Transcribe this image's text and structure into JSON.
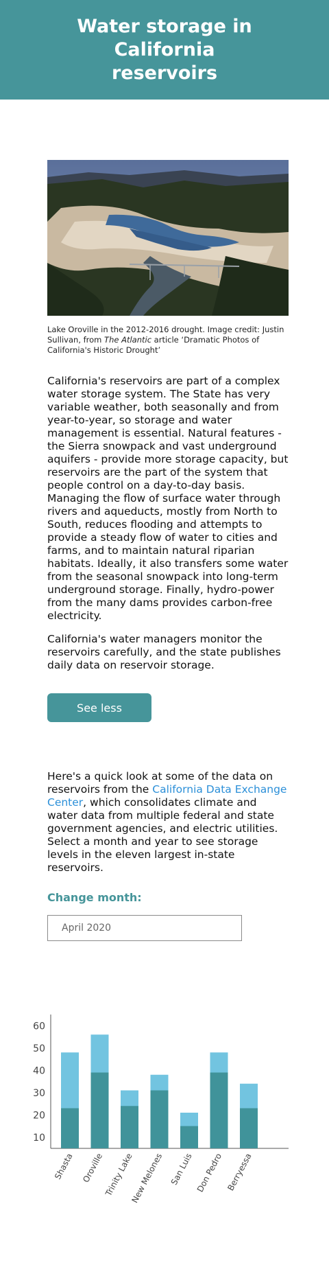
{
  "header": {
    "title": "Water storage in California reservoirs"
  },
  "photo": {
    "caption_pre": "Lake Oroville in the 2012-2016 drought. Image credit: Justin Sullivan, from ",
    "caption_italic": "The Atlantic",
    "caption_post": " article ‘Dramatic Photos of California's Historic Drought’"
  },
  "intro": {
    "p1": "California's reservoirs are part of a complex water storage system. The State has very variable weather, both seasonally and from year-to-year, so storage and water management is essential.  Natural features - the Sierra snowpack and vast underground aquifers - provide more storage capacity,  but reservoirs are the part of the system that people control on a day-to-day basis.  Managing the flow of surface water through rivers and aqueducts, mostly from North to South, reduces flooding and attempts to provide a steady flow of water to cities and farms, and to maintain natural riparian habitats.  Ideally, it also transfers some water from the seasonal snowpack into long-term underground storage.  Finally, hydro-power from the many dams provides carbon-free electricity.",
    "p2": "California's water managers monitor the reservoirs carefully, and the state publishes daily data on reservoir storage.",
    "see_less_label": "See less"
  },
  "data_intro": {
    "pre": "Here's a quick look at some of the data on reservoirs from the ",
    "link_text": "California Data Exchange Center",
    "post": ", which consolidates climate and water data from multiple federal and state government agencies, and  electric utilities. Select a month and year to see storage levels in the eleven largest in-state reservoirs."
  },
  "controls": {
    "change_month_label": "Change month:",
    "month_value": "April 2020"
  },
  "colors": {
    "brand": "#46959a",
    "bar_storage": "#40939a",
    "bar_capacity": "#72c4e0",
    "link": "#2b8fd8"
  },
  "chart_data": {
    "type": "bar",
    "categories": [
      "Shasta",
      "Oroville",
      "Trinity Lake",
      "New Melones",
      "San Luis",
      "Don Pedro",
      "Berryessa"
    ],
    "series": [
      {
        "values": [
          23,
          39,
          24,
          31,
          15,
          39,
          23
        ]
      },
      {
        "values": [
          48,
          56,
          31,
          38,
          21,
          48,
          34
        ]
      }
    ],
    "yticks": [
      10,
      20,
      30,
      40,
      50,
      60
    ],
    "ylim": [
      5,
      65
    ],
    "grid": false,
    "stacked_overlay": true
  }
}
